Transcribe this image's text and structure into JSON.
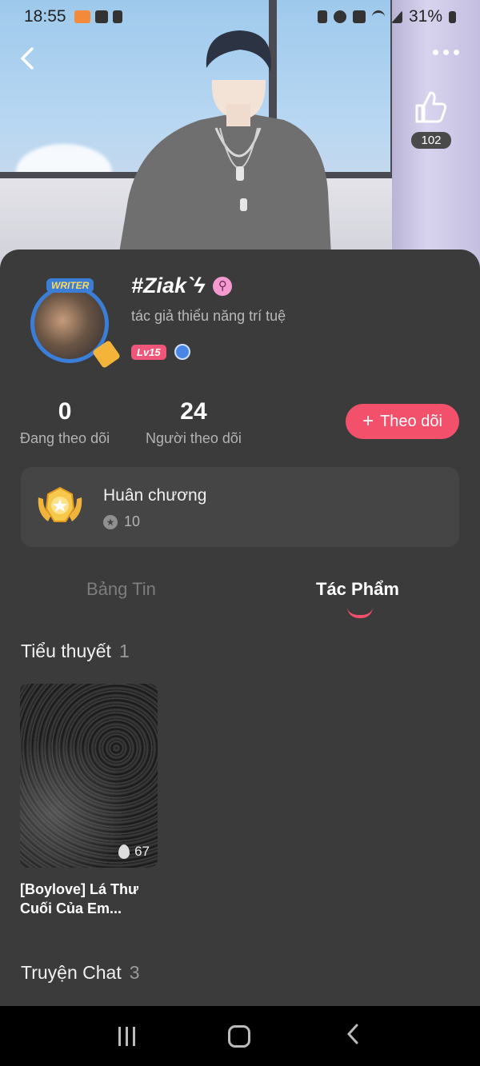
{
  "status_bar": {
    "time": "18:55",
    "battery": "31%"
  },
  "header": {
    "like_count": "102"
  },
  "profile": {
    "avatar_badge": "WRITER",
    "name": "#Ziak`ϟ",
    "gender_symbol": "⚲",
    "bio": "tác giả thiểu năng trí tuệ",
    "level": "Lv15"
  },
  "stats": {
    "following_count": "0",
    "following_label": "Đang theo dõi",
    "followers_count": "24",
    "followers_label": "Người theo dõi"
  },
  "follow_button": {
    "icon": "+",
    "label": "Theo dõi"
  },
  "medal": {
    "title": "Huân chương",
    "count": "10"
  },
  "tabs": [
    {
      "label": "Bảng Tin",
      "active": false
    },
    {
      "label": "Tác Phẩm",
      "active": true
    }
  ],
  "sections": {
    "novels": {
      "title": "Tiểu thuyết",
      "count": "1"
    },
    "chat_stories": {
      "title": "Truyện Chat",
      "count": "3"
    }
  },
  "novels": [
    {
      "title": "[Boylove] Lá Thư Cuối Của Em...",
      "views": "67"
    }
  ],
  "colors": {
    "accent": "#f2506b",
    "panel": "#3b3b3b",
    "card": "#454545"
  }
}
